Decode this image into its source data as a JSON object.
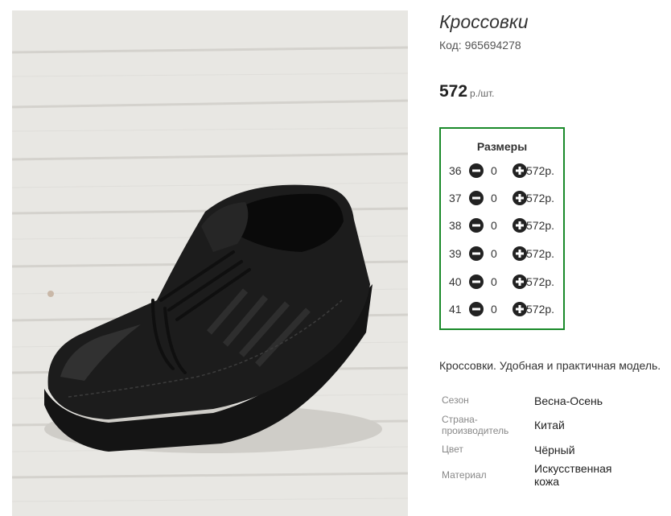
{
  "product": {
    "title": "Кроссовки",
    "code": "Код: 965694278",
    "price": "572",
    "price_unit": "р./шт.",
    "image_alt": "black-leather-sneaker"
  },
  "sizes": {
    "title": "Размеры",
    "rows": [
      {
        "size": "36",
        "qty": "0",
        "price": "572р."
      },
      {
        "size": "37",
        "qty": "0",
        "price": "572р."
      },
      {
        "size": "38",
        "qty": "0",
        "price": "572р."
      },
      {
        "size": "39",
        "qty": "0",
        "price": "572р."
      },
      {
        "size": "40",
        "qty": "0",
        "price": "572р."
      },
      {
        "size": "41",
        "qty": "0",
        "price": "572р."
      }
    ]
  },
  "description": "Кроссовки. Удобная и практичная модель.",
  "properties": [
    {
      "key": "Сезон",
      "value": "Весна-Осень"
    },
    {
      "key": "Страна-производитель",
      "value": "Китай"
    },
    {
      "key": "Цвет",
      "value": "Чёрный"
    },
    {
      "key": "Материал",
      "value": "Искусственная кожа"
    }
  ],
  "colors": {
    "accent_border": "#1a8a2a",
    "button": "#222222"
  }
}
